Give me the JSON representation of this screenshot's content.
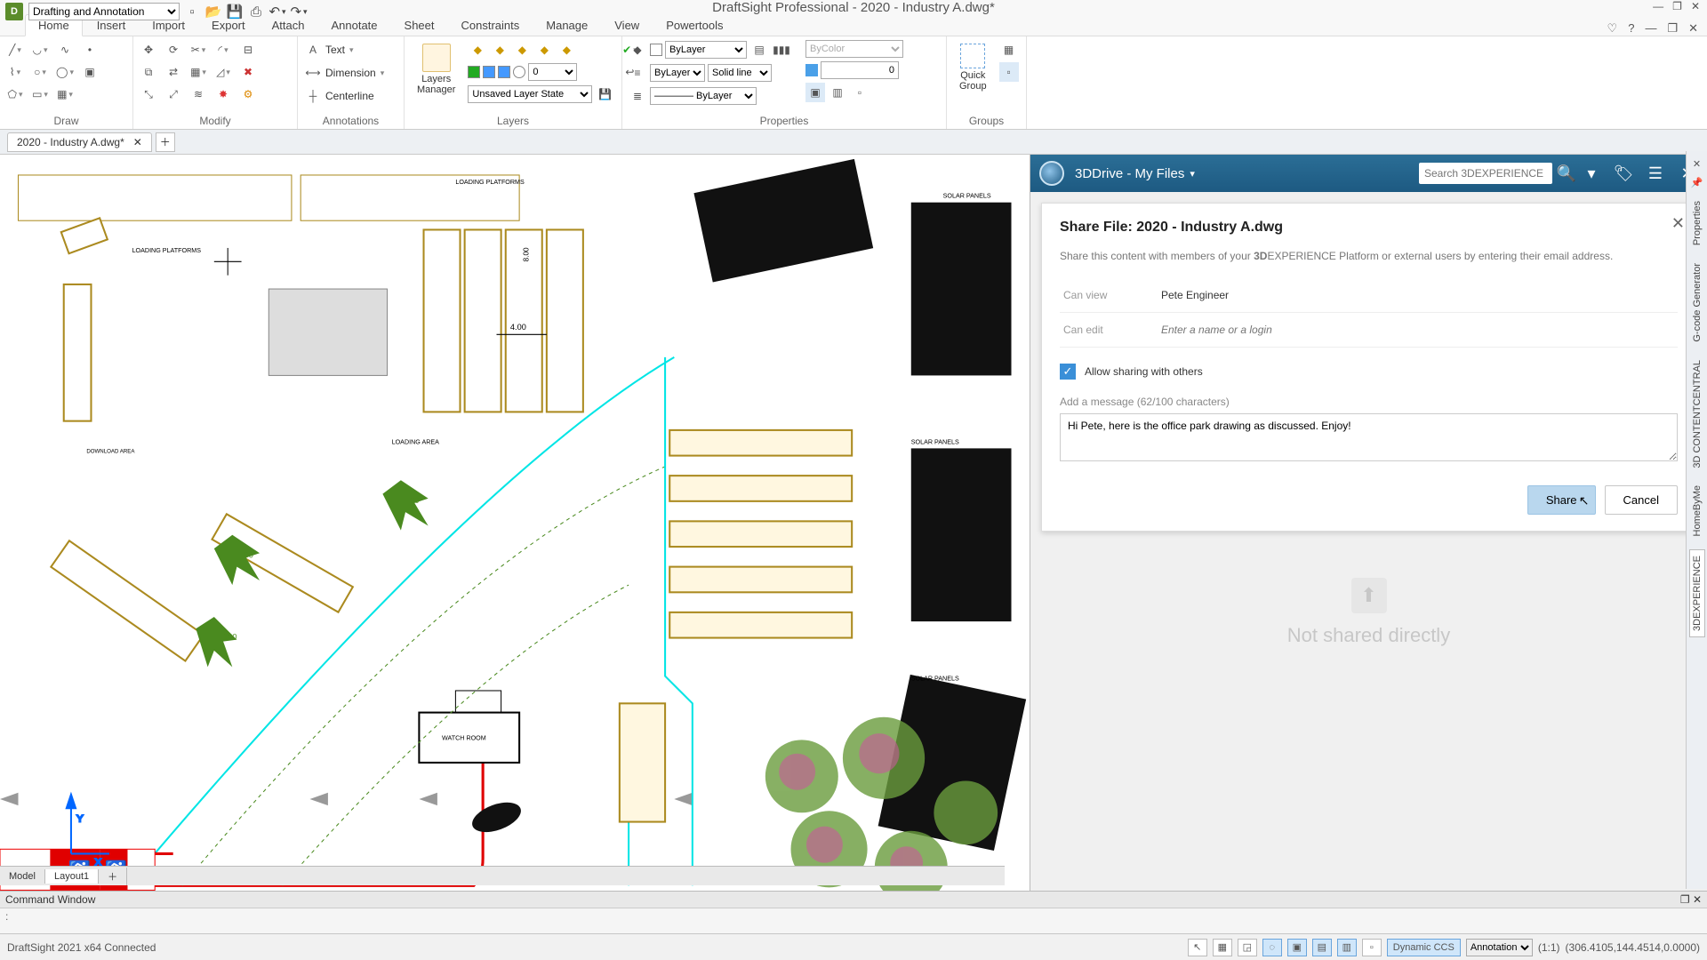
{
  "app": {
    "title": "DraftSight Professional - 2020 - Industry A.dwg*",
    "workspace": "Drafting and Annotation"
  },
  "ribbon_tabs": [
    "Home",
    "Insert",
    "Import",
    "Export",
    "Attach",
    "Annotate",
    "Sheet",
    "Constraints",
    "Manage",
    "View",
    "Powertools"
  ],
  "ribbon_groups": {
    "draw": "Draw",
    "modify": "Modify",
    "annotations": "Annotations",
    "layers": "Layers",
    "properties": "Properties",
    "groups": "Groups",
    "layers_manager": "Layers\nManager",
    "quick_group": "Quick\nGroup"
  },
  "annotations": {
    "text": "Text",
    "dimension": "Dimension",
    "centerline": "Centerline"
  },
  "layers": {
    "active_layer": "0",
    "on": "O",
    "state": "Unsaved Layer State"
  },
  "properties": {
    "bylayer1": "ByLayer",
    "bylayer2": "ByLayer",
    "solidline": "Solid line",
    "bylayer3": "ByLayer",
    "bycolor": "ByColor",
    "transparency": "0"
  },
  "doc_tab": {
    "name": "2020 - Industry A.dwg*"
  },
  "exp": {
    "drive_title": "3DDrive - My Files",
    "search_placeholder": "Search 3DEXPERIENCE"
  },
  "share": {
    "title": "Share File: 2020 - Industry A.dwg",
    "desc_pre": "Share this content with members of your ",
    "desc_bold": "3D",
    "desc_post": "EXPERIENCE Platform or external users by entering their email address.",
    "can_view_label": "Can view",
    "can_view_value": "Pete Engineer",
    "can_edit_label": "Can edit",
    "can_edit_placeholder": "Enter a name or a login",
    "allow": "Allow sharing with others",
    "msg_label": "Add a message (62/100 characters)",
    "msg_value": "Hi Pete, here is the office park drawing as discussed. Enjoy!",
    "share_btn": "Share",
    "cancel_btn": "Cancel",
    "not_shared": "Not shared directly"
  },
  "side_tabs": [
    "Properties",
    "G-code Generator",
    "3D CONTENTCENTRAL",
    "HomeByMe",
    "3DEXPERIENCE"
  ],
  "layout_tabs": {
    "model": "Model",
    "layout1": "Layout1"
  },
  "cmd": {
    "title": "Command Window",
    "prompt": ":"
  },
  "status": {
    "left": "DraftSight 2021 x64 Connected",
    "dynamic": "Dynamic CCS",
    "annotation_scale": "Annotation",
    "ratio": "(1:1)",
    "coords": "(306.4105,144.4514,0.0000)"
  }
}
